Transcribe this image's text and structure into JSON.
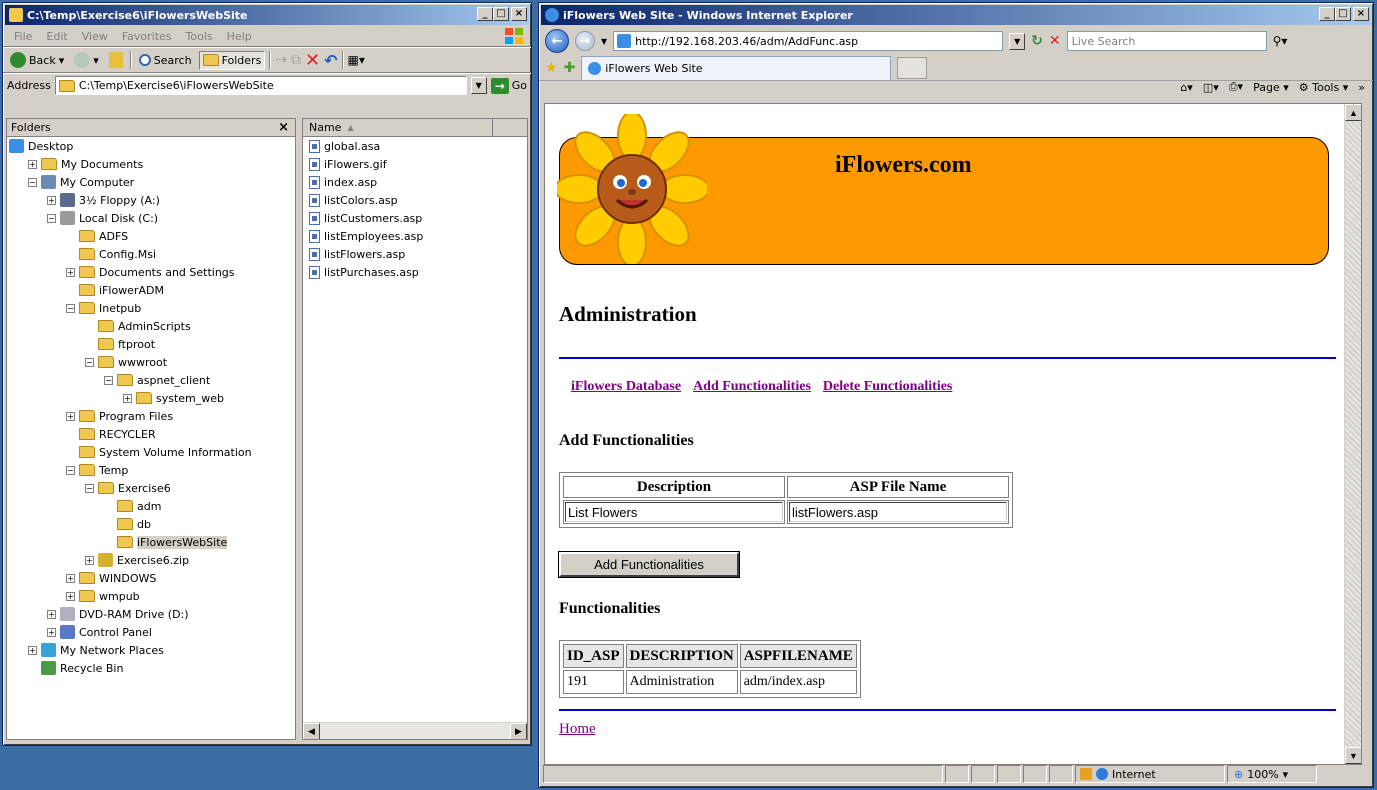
{
  "explorer": {
    "title": "C:\\Temp\\Exercise6\\iFlowersWebSite",
    "menu": [
      "File",
      "Edit",
      "View",
      "Favorites",
      "Tools",
      "Help"
    ],
    "toolbar": {
      "back": "Back",
      "search": "Search",
      "folders": "Folders"
    },
    "address_label": "Address",
    "address_value": "C:\\Temp\\Exercise6\\iFlowersWebSite",
    "go_label": "Go",
    "folders_header": "Folders",
    "close_glyph": "×",
    "name_column": "Name",
    "tree": [
      {
        "label": "Desktop",
        "icon": "desktop-icon",
        "level": 0,
        "expander": ""
      },
      {
        "label": "My Documents",
        "icon": "folder-icon",
        "level": 1,
        "expander": "+"
      },
      {
        "label": "My Computer",
        "icon": "computer-icon",
        "level": 1,
        "expander": "−"
      },
      {
        "label": "3½ Floppy (A:)",
        "icon": "floppy-icon",
        "level": 2,
        "expander": "+"
      },
      {
        "label": "Local Disk (C:)",
        "icon": "disk-icon",
        "level": 2,
        "expander": "−"
      },
      {
        "label": "ADFS",
        "icon": "folder-icon",
        "level": 3,
        "expander": ""
      },
      {
        "label": "Config.Msi",
        "icon": "folder-icon",
        "level": 3,
        "expander": ""
      },
      {
        "label": "Documents and Settings",
        "icon": "folder-icon",
        "level": 3,
        "expander": "+"
      },
      {
        "label": "iFlowerADM",
        "icon": "folder-icon",
        "level": 3,
        "expander": ""
      },
      {
        "label": "Inetpub",
        "icon": "folder-icon",
        "level": 3,
        "expander": "−"
      },
      {
        "label": "AdminScripts",
        "icon": "folder-icon",
        "level": 4,
        "expander": ""
      },
      {
        "label": "ftproot",
        "icon": "folder-icon",
        "level": 4,
        "expander": ""
      },
      {
        "label": "wwwroot",
        "icon": "folder-icon",
        "level": 4,
        "expander": "−"
      },
      {
        "label": "aspnet_client",
        "icon": "folder-icon",
        "level": 5,
        "expander": "−"
      },
      {
        "label": "system_web",
        "icon": "folder-icon",
        "level": 6,
        "expander": "+"
      },
      {
        "label": "Program Files",
        "icon": "folder-icon",
        "level": 3,
        "expander": "+"
      },
      {
        "label": "RECYCLER",
        "icon": "folder-icon",
        "level": 3,
        "expander": ""
      },
      {
        "label": "System Volume Information",
        "icon": "folder-icon",
        "level": 3,
        "expander": ""
      },
      {
        "label": "Temp",
        "icon": "folder-open-icon",
        "level": 3,
        "expander": "−"
      },
      {
        "label": "Exercise6",
        "icon": "folder-icon",
        "level": 4,
        "expander": "−"
      },
      {
        "label": "adm",
        "icon": "folder-icon",
        "level": 5,
        "expander": ""
      },
      {
        "label": "db",
        "icon": "folder-icon",
        "level": 5,
        "expander": ""
      },
      {
        "label": "iFlowersWebSite",
        "icon": "folder-icon",
        "level": 5,
        "expander": "",
        "selected": true
      },
      {
        "label": "Exercise6.zip",
        "icon": "zip-icon",
        "level": 4,
        "expander": "+"
      },
      {
        "label": "WINDOWS",
        "icon": "folder-icon",
        "level": 3,
        "expander": "+"
      },
      {
        "label": "wmpub",
        "icon": "folder-icon",
        "level": 3,
        "expander": "+"
      },
      {
        "label": "DVD-RAM Drive (D:)",
        "icon": "dvd-icon",
        "level": 2,
        "expander": "+"
      },
      {
        "label": "Control Panel",
        "icon": "control-panel-icon",
        "level": 2,
        "expander": "+"
      },
      {
        "label": "My Network Places",
        "icon": "network-icon",
        "level": 1,
        "expander": "+"
      },
      {
        "label": "Recycle Bin",
        "icon": "recycle-bin-icon",
        "level": 1,
        "expander": ""
      }
    ],
    "files": [
      "global.asa",
      "iFlowers.gif",
      "index.asp",
      "listColors.asp",
      "listCustomers.asp",
      "listEmployees.asp",
      "listFlowers.asp",
      "listPurchases.asp"
    ]
  },
  "ie": {
    "title": "iFlowers Web Site - Windows Internet Explorer",
    "url": "http://192.168.203.46/adm/AddFunc.asp",
    "search_placeholder": "Live Search",
    "tab_label": "iFlowers Web Site",
    "cmd": {
      "page": "Page",
      "tools": "Tools"
    },
    "status": {
      "zone": "Internet",
      "zoom": "100%"
    }
  },
  "page": {
    "banner_title": "iFlowers.com",
    "heading": "Administration",
    "links": [
      "iFlowers Database",
      "Add Functionalities",
      "Delete Functionalities"
    ],
    "add_heading": "Add Functionalities",
    "form": {
      "headers": [
        "Description",
        "ASP File Name"
      ],
      "description_value": "List Flowers",
      "asp_value": "listFlowers.asp"
    },
    "add_button": "Add Functionalities",
    "func_heading": "Functionalities",
    "func_table": {
      "headers": [
        "ID_ASP",
        "DESCRIPTION",
        "ASPFILENAME"
      ],
      "rows": [
        [
          "191",
          "Administration",
          "adm/index.asp"
        ]
      ]
    },
    "home_link": "Home"
  },
  "colors": {
    "banner": "#ff9900",
    "rule": "#0000cc",
    "visited_link": "#800080",
    "desktop": "#3a6ea5"
  }
}
